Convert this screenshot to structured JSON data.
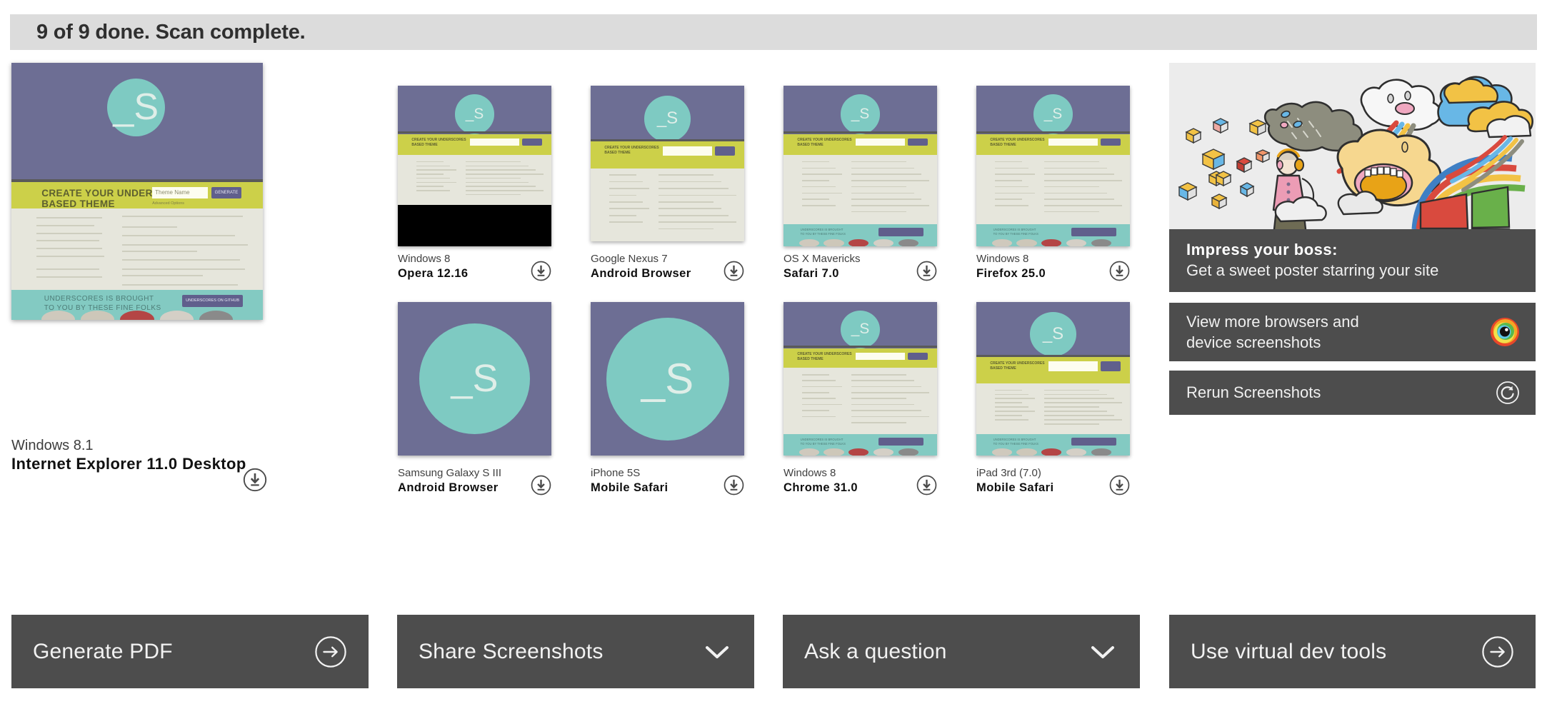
{
  "status": {
    "text": "9 of 9 done. Scan complete."
  },
  "featured": {
    "os": "Windows 8.1",
    "browser": "Internet Explorer 11.0 Desktop",
    "download_icon": "download-icon"
  },
  "thumbnails": [
    {
      "os": "Windows 8",
      "browser": "Opera 12.16",
      "variant": "opera"
    },
    {
      "os": "Google Nexus 7",
      "browser": "Android Browser",
      "variant": "nexus7"
    },
    {
      "os": "OS X Mavericks",
      "browser": "Safari 7.0",
      "variant": "safari"
    },
    {
      "os": "Windows 8",
      "browser": "Firefox 25.0",
      "variant": "firefox"
    },
    {
      "os": "Samsung Galaxy S III",
      "browser": "Android Browser",
      "variant": "galaxy"
    },
    {
      "os": "iPhone 5S",
      "browser": "Mobile Safari",
      "variant": "iphone"
    },
    {
      "os": "Windows 8",
      "browser": "Chrome 31.0",
      "variant": "chrome"
    },
    {
      "os": "iPad 3rd (7.0)",
      "browser": "Mobile Safari",
      "variant": "ipad"
    }
  ],
  "poster": {
    "image_name": "poster-illustration",
    "headline": "Impress your boss:",
    "subline": "Get a sweet poster starring your site"
  },
  "rail_buttons": [
    {
      "label_line1": "View more browsers and",
      "label_line2": "device screenshots",
      "icon": "browser-eye-icon"
    },
    {
      "label_line1": "Rerun Screenshots",
      "label_line2": "",
      "icon": "rerun-icon"
    }
  ],
  "actions": [
    {
      "label": "Generate PDF",
      "icon": "arrow-right-circle-icon"
    },
    {
      "label": "Share Screenshots",
      "icon": "chevron-down-icon"
    },
    {
      "label": "Ask a question",
      "icon": "chevron-down-icon"
    },
    {
      "label": "Use virtual dev tools",
      "icon": "arrow-right-circle-icon"
    }
  ],
  "site_preview": {
    "band_title_line1": "CREATE YOUR UNDERSCORES",
    "band_title_line2": "BASED THEME",
    "input_placeholder": "Theme Name",
    "generate_label": "GENERATE",
    "advanced_label": "Advanced Options",
    "footer_line1": "UNDERSCORES IS BROUGHT",
    "footer_line2": "TO YOU BY THESE FINE FOLKS",
    "footer_button": "UNDERSCORES ON GITHUB",
    "logo_glyph": "_S"
  },
  "colors": {
    "panel_dark": "#4d4d4d",
    "status_bg": "#dcdcdc",
    "hero_purple": "#6d6e94",
    "band_yellow": "#ccd049",
    "footer_teal": "#83cac2",
    "logo_teal": "#7ecac2",
    "body_cream": "#e6e6dc"
  }
}
